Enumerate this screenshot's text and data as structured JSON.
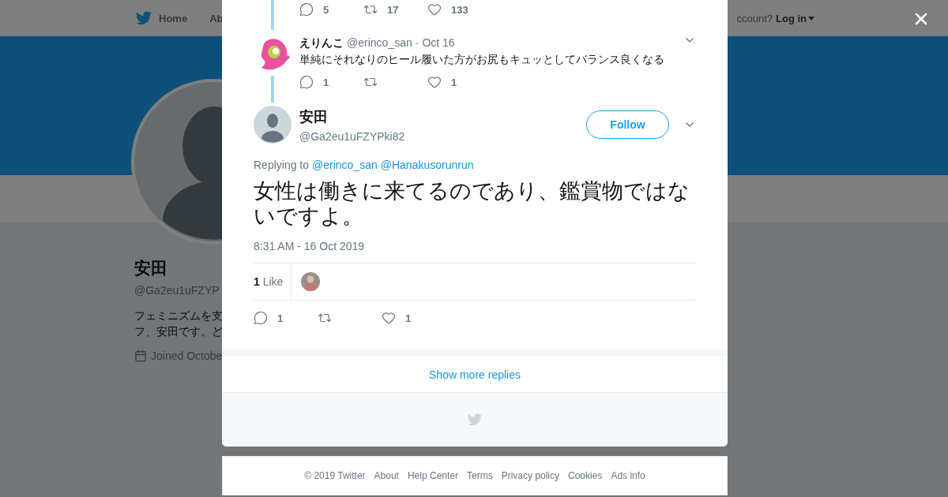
{
  "navbar": {
    "items": [
      {
        "label": "Home",
        "selected": false
      },
      {
        "label": "Ab",
        "selected": false
      }
    ],
    "account_prompt": "ccount?",
    "login": "Log in"
  },
  "profile": {
    "name": "安田",
    "handle": "@Ga2eu1uFZYP",
    "bio_lines": [
      "フェミニズムを支",
      "フ、安田です。ど"
    ],
    "joined": "Joined Octobe"
  },
  "modal": {
    "previous_actions": [
      {
        "kind": "reply",
        "count": "5"
      },
      {
        "kind": "retweet",
        "count": "17"
      },
      {
        "kind": "like",
        "count": "133"
      }
    ],
    "reply": {
      "name": "えりんこ",
      "handle": "@erinco_san",
      "separator": "·",
      "date": "Oct 16",
      "text": "単純にそれなりのヒール履いた方がお尻もキュッとしてバランス良くなる",
      "actions": [
        {
          "kind": "reply",
          "count": "1"
        },
        {
          "kind": "retweet"
        },
        {
          "kind": "like",
          "count": "1"
        }
      ]
    },
    "tweet": {
      "name": "安田",
      "handle": "@Ga2eu1uFZYPki82",
      "follow": "Follow",
      "replying_label": "Replying to",
      "replying_to": [
        "@erinco_san",
        "@Hanakusorunrun"
      ],
      "text": "女性は働きに来てるのであり、鑑賞物ではないですよ。",
      "timestamp": "8:31 AM - 16 Oct 2019",
      "likes": "**1** Like",
      "actions": [
        {
          "kind": "reply",
          "count": "1"
        },
        {
          "kind": "retweet"
        },
        {
          "kind": "like",
          "count": "1"
        }
      ]
    },
    "show_more": "Show more replies"
  },
  "footer": [
    "© 2019 Twitter",
    "About",
    "Help Center",
    "Terms",
    "Privacy policy",
    "Cookies",
    "Ads info"
  ]
}
